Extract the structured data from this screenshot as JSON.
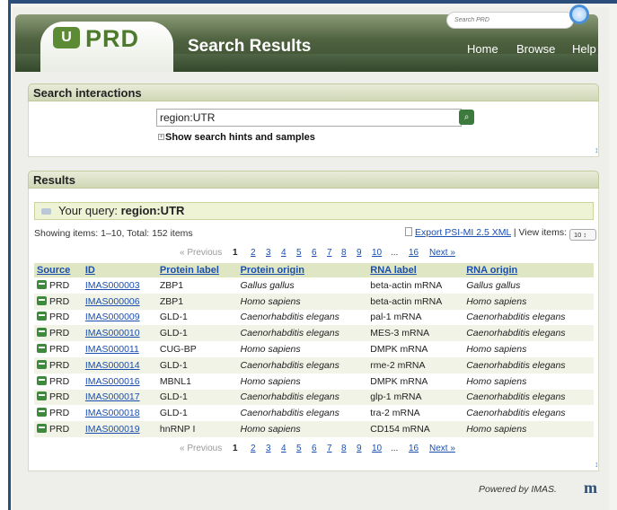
{
  "header": {
    "logo_mark": "U",
    "logo_text": "PRD",
    "title": "Search Results",
    "search_placeholder": "Search PRD",
    "nav": [
      "Home",
      "Browse",
      "Help"
    ]
  },
  "search_panel": {
    "title": "Search interactions",
    "query_value": "region:UTR",
    "go_glyph": "⌕",
    "hints_label": "Show search hints and samples",
    "scroll_glyph": "↕"
  },
  "results_panel": {
    "title": "Results",
    "your_query_label": "Your query: ",
    "your_query_value": "region:UTR",
    "showing": "Showing items: 1–10, Total: 152 items",
    "export_label": "Export PSI-MI 2.5 XML",
    "view_items_label": " | View items:",
    "view_items_value": "10 ↕",
    "pager": {
      "prev": "« Previous",
      "current": "1",
      "pages": [
        "2",
        "3",
        "4",
        "5",
        "6",
        "7",
        "8",
        "9",
        "10"
      ],
      "dots": "...",
      "last": "16",
      "next": "Next »"
    },
    "columns": [
      "Source",
      "ID",
      "Protein label",
      "Protein origin",
      "RNA label",
      "RNA origin"
    ],
    "rows": [
      [
        "PRD",
        "IMAS000003",
        "ZBP1",
        "Gallus gallus",
        "beta-actin mRNA",
        "Gallus gallus"
      ],
      [
        "PRD",
        "IMAS000006",
        "ZBP1",
        "Homo sapiens",
        "beta-actin mRNA",
        "Homo sapiens"
      ],
      [
        "PRD",
        "IMAS000009",
        "GLD-1",
        "Caenorhabditis elegans",
        "pal-1 mRNA",
        "Caenorhabditis elegans"
      ],
      [
        "PRD",
        "IMAS000010",
        "GLD-1",
        "Caenorhabditis elegans",
        "MES-3 mRNA",
        "Caenorhabditis elegans"
      ],
      [
        "PRD",
        "IMAS000011",
        "CUG-BP",
        "Homo sapiens",
        "DMPK mRNA",
        "Homo sapiens"
      ],
      [
        "PRD",
        "IMAS000014",
        "GLD-1",
        "Caenorhabditis elegans",
        "rme-2 mRNA",
        "Caenorhabditis elegans"
      ],
      [
        "PRD",
        "IMAS000016",
        "MBNL1",
        "Homo sapiens",
        "DMPK mRNA",
        "Homo sapiens"
      ],
      [
        "PRD",
        "IMAS000017",
        "GLD-1",
        "Caenorhabditis elegans",
        "glp-1 mRNA",
        "Caenorhabditis elegans"
      ],
      [
        "PRD",
        "IMAS000018",
        "GLD-1",
        "Caenorhabditis elegans",
        "tra-2 mRNA",
        "Caenorhabditis elegans"
      ],
      [
        "PRD",
        "IMAS000019",
        "hnRNP I",
        "Homo sapiens",
        "CD154 mRNA",
        "Homo sapiens"
      ]
    ],
    "scroll_glyph": "↕"
  },
  "footer": {
    "powered_by": "Powered by IMAS.",
    "logo": "m"
  },
  "colors": {
    "header_green": "#4e6240",
    "logo_green": "#4d7a2c",
    "link_blue": "#1a4fb0",
    "panel_head": "#dfe6c4",
    "frame_blue": "#2a4d7a"
  }
}
